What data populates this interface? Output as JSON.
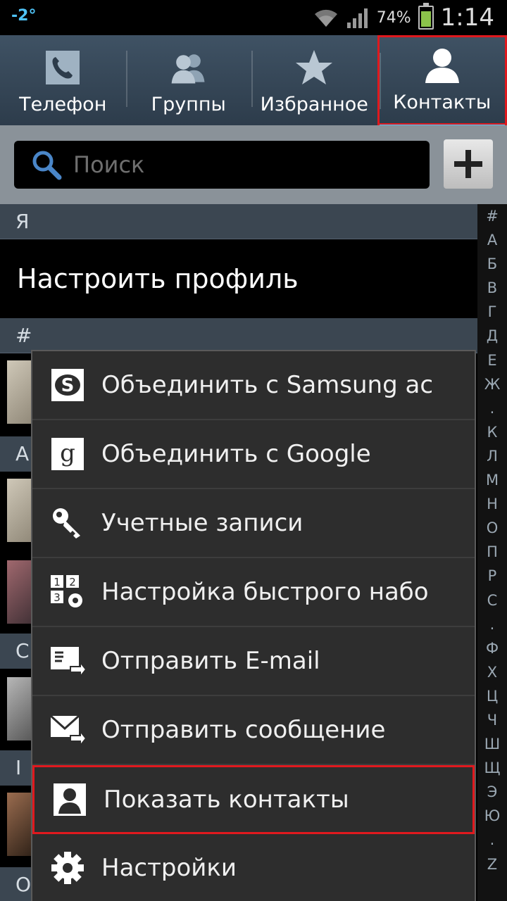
{
  "status_bar": {
    "temperature": "-2°",
    "battery_percent": "74%",
    "battery_level": 0.74,
    "time": "1:14"
  },
  "tabs": [
    {
      "label": "Телефон",
      "icon": "phone-icon",
      "active": false
    },
    {
      "label": "Группы",
      "icon": "group-icon",
      "active": false
    },
    {
      "label": "Избранное",
      "icon": "star-icon",
      "active": false
    },
    {
      "label": "Контакты",
      "icon": "contact-icon",
      "active": true
    }
  ],
  "search": {
    "placeholder": "Поиск",
    "value": ""
  },
  "list": {
    "me_header": "Я",
    "profile_label": "Настроить профиль",
    "hash_header": "#",
    "partial_letters": [
      "A",
      "C",
      "I",
      "O"
    ]
  },
  "alphabet_index": [
    "#",
    "А",
    "Б",
    "В",
    "Г",
    "Д",
    "Е",
    "Ж",
    ".",
    "К",
    "Л",
    "М",
    "Н",
    "О",
    "П",
    "Р",
    "С",
    ".",
    "Ф",
    "Х",
    "Ц",
    "Ч",
    "Ш",
    "Щ",
    "Э",
    "Ю",
    ".",
    "Z"
  ],
  "menu": {
    "items": [
      {
        "label": "Объединить с Samsung ac",
        "icon": "samsung-account-icon"
      },
      {
        "label": "Объединить с Google",
        "icon": "google-icon"
      },
      {
        "label": "Учетные записи",
        "icon": "key-icon"
      },
      {
        "label": "Настройка быстрого набо",
        "icon": "speed-dial-icon"
      },
      {
        "label": "Отправить E-mail",
        "icon": "email-icon"
      },
      {
        "label": "Отправить сообщение",
        "icon": "message-icon"
      },
      {
        "label": "Показать контакты",
        "icon": "person-icon",
        "highlighted": true
      },
      {
        "label": "Настройки",
        "icon": "settings-gear-icon"
      }
    ]
  },
  "colors": {
    "highlight": "#e0191e",
    "accent": "#4fc3f7",
    "battery": "#8bc34a"
  }
}
